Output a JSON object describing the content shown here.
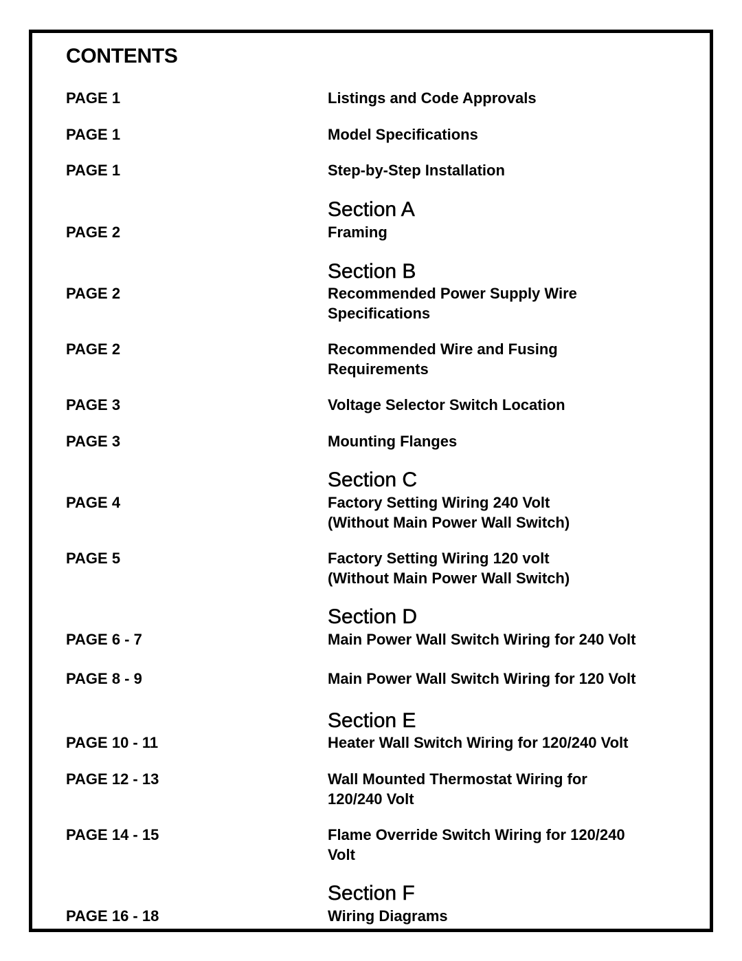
{
  "document": {
    "title": "CONTENTS",
    "toc": [
      {
        "page": "PAGE 1",
        "title": "Listings and Code Approvals"
      },
      {
        "page": "PAGE 1",
        "title": "Model Specifications"
      },
      {
        "page": "PAGE 1",
        "title": "Step-by-Step Installation"
      }
    ],
    "sections": [
      {
        "heading": "Section A",
        "entries": [
          {
            "page": "PAGE 2",
            "title": "Framing"
          }
        ]
      },
      {
        "heading": "Section B",
        "entries": [
          {
            "page": "PAGE 2",
            "title": "Recommended Power Supply Wire\nSpecifications"
          },
          {
            "page": "PAGE 2",
            "title": "Recommended Wire and Fusing\nRequirements"
          },
          {
            "page": "PAGE 3",
            "title": "Voltage Selector Switch Location"
          },
          {
            "page": "PAGE 3",
            "title": "Mounting Flanges"
          }
        ]
      },
      {
        "heading": "Section C",
        "entries": [
          {
            "page": "PAGE 4",
            "title": "Factory Setting Wiring 240 Volt\n(Without Main Power Wall Switch)"
          },
          {
            "page": "PAGE 5",
            "title": "Factory Setting Wiring 120 volt\n(Without Main Power Wall Switch)"
          }
        ]
      },
      {
        "heading": "Section D",
        "entries": [
          {
            "page": "PAGE 6 - 7",
            "title": "Main Power Wall Switch Wiring for 240 Volt"
          },
          {
            "page": "PAGE 8 - 9",
            "title": "Main Power Wall Switch Wiring for 120 Volt"
          }
        ]
      },
      {
        "heading": "Section E",
        "entries": [
          {
            "page": "PAGE 10 - 11",
            "title": "Heater Wall Switch Wiring for 120/240 Volt"
          },
          {
            "page": "PAGE 12 - 13",
            "title": "Wall Mounted Thermostat Wiring for\n120/240 Volt"
          },
          {
            "page": "PAGE 14 - 15",
            "title": "Flame Override Switch Wiring for 120/240\nVolt"
          }
        ]
      },
      {
        "heading": "Section F",
        "entries": [
          {
            "page": "PAGE 16 - 18",
            "title": "Wiring Diagrams"
          }
        ]
      }
    ]
  }
}
